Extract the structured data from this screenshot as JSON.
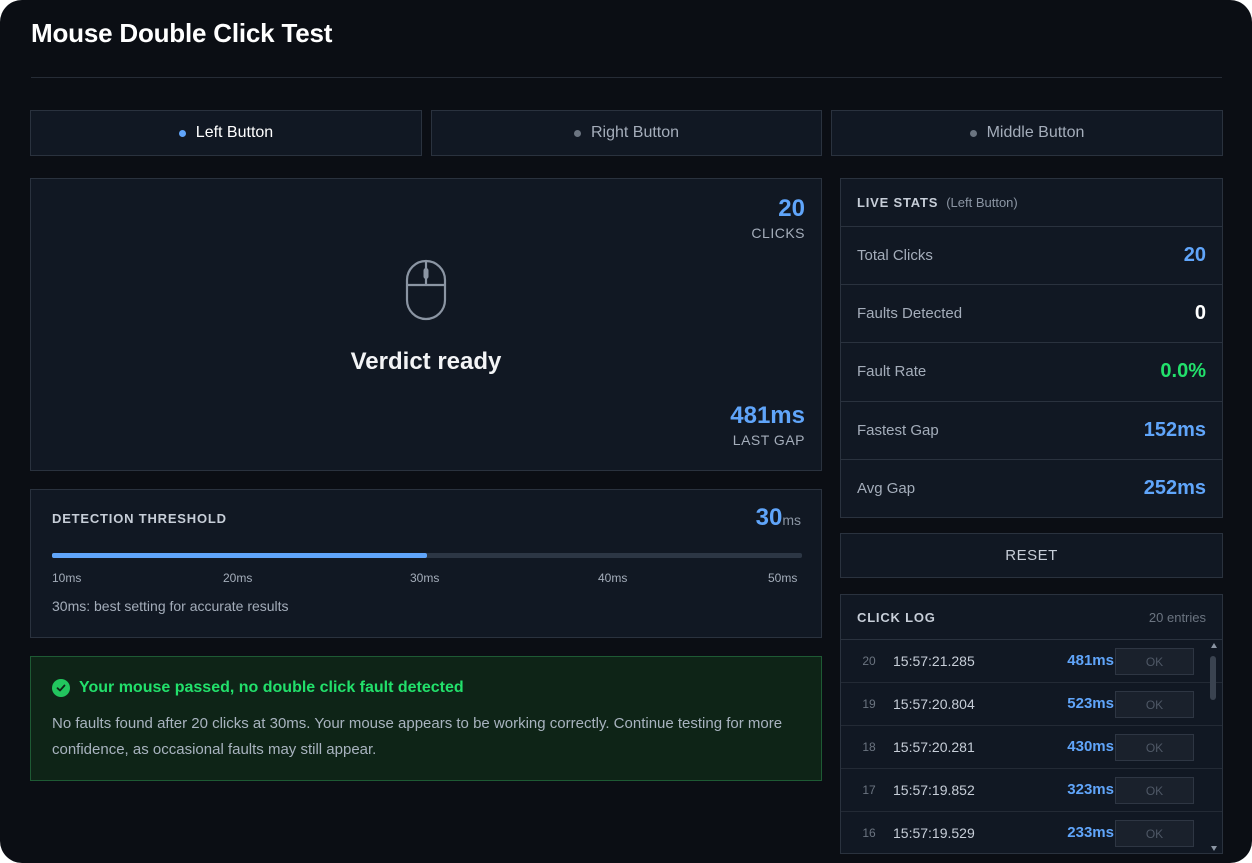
{
  "app": {
    "title": "Mouse Double Click Test"
  },
  "tabs": [
    {
      "label": "Left Button",
      "active": true
    },
    {
      "label": "Right Button",
      "active": false
    },
    {
      "label": "Middle Button",
      "active": false
    }
  ],
  "click_area": {
    "clicks_value": "20",
    "clicks_label": "CLICKS",
    "verdict": "Verdict ready",
    "last_gap_value": "481ms",
    "last_gap_label": "LAST GAP",
    "icon": "mouse-icon"
  },
  "threshold": {
    "label": "DETECTION THRESHOLD",
    "value": "30",
    "unit": "ms",
    "slider_fraction": 0.5,
    "ticks": [
      "10ms",
      "20ms",
      "30ms",
      "40ms",
      "50ms"
    ],
    "note": "30ms: best setting for accurate results"
  },
  "result": {
    "headline": "Your mouse passed, no double click fault detected",
    "body": "No faults found after 20 clicks at 30ms. Your mouse appears to be working correctly. Continue testing for more confidence, as occasional faults may still appear.",
    "icon": "check-circle-icon"
  },
  "stats": {
    "heading": "LIVE STATS",
    "sub": "(Left Button)",
    "rows": [
      {
        "label": "Total Clicks",
        "value": "20",
        "color": "#60a5fa"
      },
      {
        "label": "Faults Detected",
        "value": "0",
        "color": "#ffffff"
      },
      {
        "label": "Fault Rate",
        "value": "0.0%",
        "color": "#22e06b"
      },
      {
        "label": "Fastest Gap",
        "value": "152ms",
        "color": "#60a5fa"
      },
      {
        "label": "Avg Gap",
        "value": "252ms",
        "color": "#60a5fa"
      }
    ]
  },
  "reset_label": "RESET",
  "log": {
    "heading": "CLICK LOG",
    "count": "20 entries",
    "entries": [
      {
        "idx": "20",
        "time": "15:57:21.285",
        "gap": "481ms",
        "status": "OK"
      },
      {
        "idx": "19",
        "time": "15:57:20.804",
        "gap": "523ms",
        "status": "OK"
      },
      {
        "idx": "18",
        "time": "15:57:20.281",
        "gap": "430ms",
        "status": "OK"
      },
      {
        "idx": "17",
        "time": "15:57:19.852",
        "gap": "323ms",
        "status": "OK"
      },
      {
        "idx": "16",
        "time": "15:57:19.529",
        "gap": "233ms",
        "status": "OK"
      }
    ]
  },
  "colors": {
    "accent": "#60a5fa",
    "success": "#22e06b",
    "background": "#0b0e14",
    "panel": "#111823"
  }
}
